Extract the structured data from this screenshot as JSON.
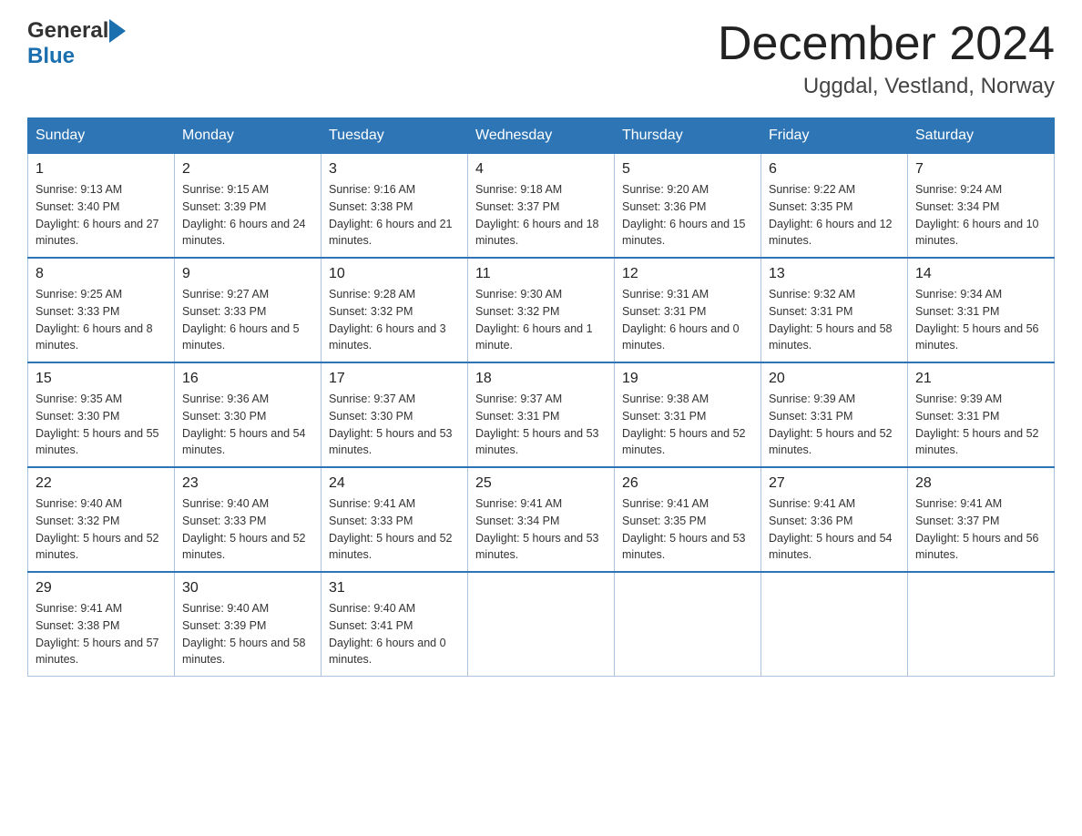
{
  "header": {
    "logo_general": "General",
    "logo_blue": "Blue",
    "month_title": "December 2024",
    "location": "Uggdal, Vestland, Norway"
  },
  "calendar": {
    "days_of_week": [
      "Sunday",
      "Monday",
      "Tuesday",
      "Wednesday",
      "Thursday",
      "Friday",
      "Saturday"
    ],
    "weeks": [
      [
        {
          "day": "1",
          "sunrise": "Sunrise: 9:13 AM",
          "sunset": "Sunset: 3:40 PM",
          "daylight": "Daylight: 6 hours and 27 minutes."
        },
        {
          "day": "2",
          "sunrise": "Sunrise: 9:15 AM",
          "sunset": "Sunset: 3:39 PM",
          "daylight": "Daylight: 6 hours and 24 minutes."
        },
        {
          "day": "3",
          "sunrise": "Sunrise: 9:16 AM",
          "sunset": "Sunset: 3:38 PM",
          "daylight": "Daylight: 6 hours and 21 minutes."
        },
        {
          "day": "4",
          "sunrise": "Sunrise: 9:18 AM",
          "sunset": "Sunset: 3:37 PM",
          "daylight": "Daylight: 6 hours and 18 minutes."
        },
        {
          "day": "5",
          "sunrise": "Sunrise: 9:20 AM",
          "sunset": "Sunset: 3:36 PM",
          "daylight": "Daylight: 6 hours and 15 minutes."
        },
        {
          "day": "6",
          "sunrise": "Sunrise: 9:22 AM",
          "sunset": "Sunset: 3:35 PM",
          "daylight": "Daylight: 6 hours and 12 minutes."
        },
        {
          "day": "7",
          "sunrise": "Sunrise: 9:24 AM",
          "sunset": "Sunset: 3:34 PM",
          "daylight": "Daylight: 6 hours and 10 minutes."
        }
      ],
      [
        {
          "day": "8",
          "sunrise": "Sunrise: 9:25 AM",
          "sunset": "Sunset: 3:33 PM",
          "daylight": "Daylight: 6 hours and 8 minutes."
        },
        {
          "day": "9",
          "sunrise": "Sunrise: 9:27 AM",
          "sunset": "Sunset: 3:33 PM",
          "daylight": "Daylight: 6 hours and 5 minutes."
        },
        {
          "day": "10",
          "sunrise": "Sunrise: 9:28 AM",
          "sunset": "Sunset: 3:32 PM",
          "daylight": "Daylight: 6 hours and 3 minutes."
        },
        {
          "day": "11",
          "sunrise": "Sunrise: 9:30 AM",
          "sunset": "Sunset: 3:32 PM",
          "daylight": "Daylight: 6 hours and 1 minute."
        },
        {
          "day": "12",
          "sunrise": "Sunrise: 9:31 AM",
          "sunset": "Sunset: 3:31 PM",
          "daylight": "Daylight: 6 hours and 0 minutes."
        },
        {
          "day": "13",
          "sunrise": "Sunrise: 9:32 AM",
          "sunset": "Sunset: 3:31 PM",
          "daylight": "Daylight: 5 hours and 58 minutes."
        },
        {
          "day": "14",
          "sunrise": "Sunrise: 9:34 AM",
          "sunset": "Sunset: 3:31 PM",
          "daylight": "Daylight: 5 hours and 56 minutes."
        }
      ],
      [
        {
          "day": "15",
          "sunrise": "Sunrise: 9:35 AM",
          "sunset": "Sunset: 3:30 PM",
          "daylight": "Daylight: 5 hours and 55 minutes."
        },
        {
          "day": "16",
          "sunrise": "Sunrise: 9:36 AM",
          "sunset": "Sunset: 3:30 PM",
          "daylight": "Daylight: 5 hours and 54 minutes."
        },
        {
          "day": "17",
          "sunrise": "Sunrise: 9:37 AM",
          "sunset": "Sunset: 3:30 PM",
          "daylight": "Daylight: 5 hours and 53 minutes."
        },
        {
          "day": "18",
          "sunrise": "Sunrise: 9:37 AM",
          "sunset": "Sunset: 3:31 PM",
          "daylight": "Daylight: 5 hours and 53 minutes."
        },
        {
          "day": "19",
          "sunrise": "Sunrise: 9:38 AM",
          "sunset": "Sunset: 3:31 PM",
          "daylight": "Daylight: 5 hours and 52 minutes."
        },
        {
          "day": "20",
          "sunrise": "Sunrise: 9:39 AM",
          "sunset": "Sunset: 3:31 PM",
          "daylight": "Daylight: 5 hours and 52 minutes."
        },
        {
          "day": "21",
          "sunrise": "Sunrise: 9:39 AM",
          "sunset": "Sunset: 3:31 PM",
          "daylight": "Daylight: 5 hours and 52 minutes."
        }
      ],
      [
        {
          "day": "22",
          "sunrise": "Sunrise: 9:40 AM",
          "sunset": "Sunset: 3:32 PM",
          "daylight": "Daylight: 5 hours and 52 minutes."
        },
        {
          "day": "23",
          "sunrise": "Sunrise: 9:40 AM",
          "sunset": "Sunset: 3:33 PM",
          "daylight": "Daylight: 5 hours and 52 minutes."
        },
        {
          "day": "24",
          "sunrise": "Sunrise: 9:41 AM",
          "sunset": "Sunset: 3:33 PM",
          "daylight": "Daylight: 5 hours and 52 minutes."
        },
        {
          "day": "25",
          "sunrise": "Sunrise: 9:41 AM",
          "sunset": "Sunset: 3:34 PM",
          "daylight": "Daylight: 5 hours and 53 minutes."
        },
        {
          "day": "26",
          "sunrise": "Sunrise: 9:41 AM",
          "sunset": "Sunset: 3:35 PM",
          "daylight": "Daylight: 5 hours and 53 minutes."
        },
        {
          "day": "27",
          "sunrise": "Sunrise: 9:41 AM",
          "sunset": "Sunset: 3:36 PM",
          "daylight": "Daylight: 5 hours and 54 minutes."
        },
        {
          "day": "28",
          "sunrise": "Sunrise: 9:41 AM",
          "sunset": "Sunset: 3:37 PM",
          "daylight": "Daylight: 5 hours and 56 minutes."
        }
      ],
      [
        {
          "day": "29",
          "sunrise": "Sunrise: 9:41 AM",
          "sunset": "Sunset: 3:38 PM",
          "daylight": "Daylight: 5 hours and 57 minutes."
        },
        {
          "day": "30",
          "sunrise": "Sunrise: 9:40 AM",
          "sunset": "Sunset: 3:39 PM",
          "daylight": "Daylight: 5 hours and 58 minutes."
        },
        {
          "day": "31",
          "sunrise": "Sunrise: 9:40 AM",
          "sunset": "Sunset: 3:41 PM",
          "daylight": "Daylight: 6 hours and 0 minutes."
        },
        null,
        null,
        null,
        null
      ]
    ]
  }
}
